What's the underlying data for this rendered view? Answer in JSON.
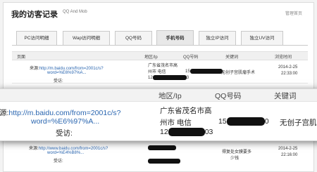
{
  "header": {
    "title": "我的访客记录",
    "subtitle": "QQ And Mob",
    "manage_link": "管理首页"
  },
  "tabs": [
    {
      "label": "PC访问明细",
      "active": false
    },
    {
      "label": "Wap访问明细",
      "active": false
    },
    {
      "label": "QQ号码",
      "active": false
    },
    {
      "label": "手机号码",
      "active": true
    },
    {
      "label": "独立IP访问",
      "active": false
    },
    {
      "label": "独立UV访问",
      "active": false
    }
  ],
  "table": {
    "columns": [
      "页面",
      "地区/Ip",
      "QQ号码",
      "关键词",
      "浏览时间"
    ],
    "row1": {
      "source_prefix": "来源:",
      "source_link_1": "http://m.baidu.com/from=2001c/s?",
      "source_link_2": "word=%E6%97%A...",
      "visit_label": "受访:",
      "region": "广东省茂名市高",
      "region_2": "州市 电信",
      "ip_prefix": "12",
      "ip_suffix": "3",
      "qq_prefix": "15",
      "keyword": "无创子宫肌瘤手术",
      "date": "2014-2-25",
      "time": "22:33:00"
    },
    "row2": {
      "source_prefix": "来源:",
      "source_link_1": "http://www.baidu.com/from=2001c/s?",
      "source_link_2": "word=%E4%B8%...",
      "visit_label": "受访:",
      "keyword": "得复处女膜要多",
      "keyword_2": "少钱",
      "date": "2014-2-25",
      "time": "22:16:00"
    }
  },
  "zoom": {
    "columns": [
      "地区/Ip",
      "QQ号码",
      "关键词"
    ],
    "source_prefix": "源:",
    "source_link_1": "http://m.baidu.com/from=2001c/s?",
    "source_link_2": "word=%E6%97%A...",
    "visit_label": "受访:",
    "region": "广东省茂名市高",
    "region_2": "州市 电信",
    "ip_prefix": "12",
    "ip_suffix": "03",
    "qq_prefix": "15",
    "qq_suffix": "0",
    "keyword": "无创子宫肌"
  }
}
